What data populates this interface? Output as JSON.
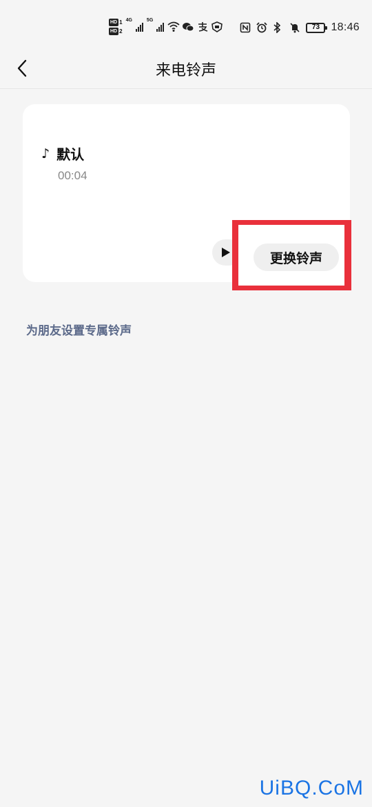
{
  "status_bar": {
    "hd1_label": "HD",
    "hd1_num": "1",
    "hd2_label": "HD",
    "hd2_num": "2",
    "network1": "4G",
    "network2": "5G",
    "battery_level": "73",
    "time": "18:46",
    "icons": [
      "wifi-icon",
      "wechat-icon",
      "alipay-icon",
      "shield-app-icon",
      "nfc-icon",
      "alarm-icon",
      "bluetooth-icon",
      "mute-icon"
    ]
  },
  "header": {
    "back_icon": "chevron-left-icon",
    "title": "来电铃声"
  },
  "ringtone_card": {
    "note_icon": "music-note-icon",
    "name": "默认",
    "duration": "00:04",
    "play_icon": "play-icon",
    "change_label": "更换铃声"
  },
  "friend_link": "为朋友设置专属铃声",
  "watermark": "UiBQ.CoM",
  "colors": {
    "background": "#f5f5f5",
    "card": "#ffffff",
    "link": "#5c6a8a",
    "highlight": "#e9303b",
    "watermark": "#1b74e4"
  }
}
